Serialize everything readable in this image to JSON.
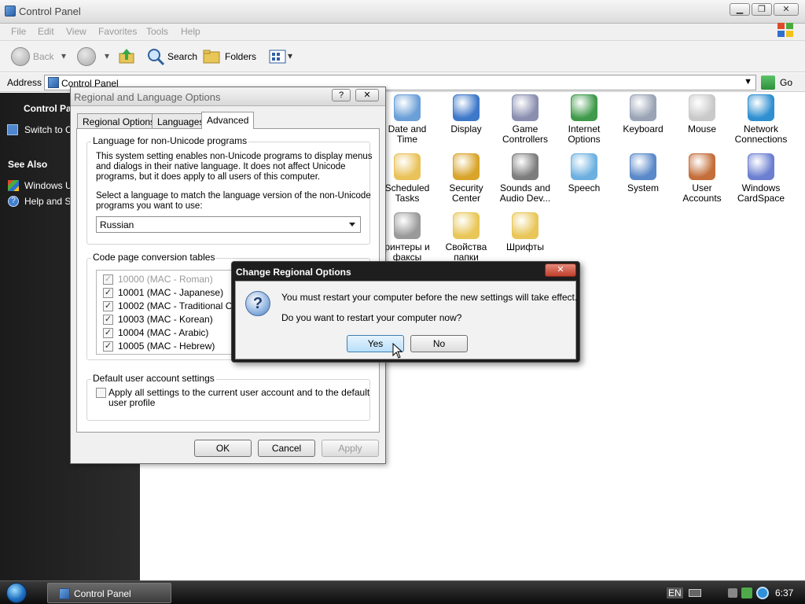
{
  "window": {
    "title": "Control Panel",
    "menu": [
      "File",
      "Edit",
      "View",
      "Favorites",
      "Tools",
      "Help"
    ],
    "toolbar": {
      "back": "Back",
      "search": "Search",
      "folders": "Folders"
    },
    "address_label": "Address",
    "address_value": "Control Panel",
    "go_label": "Go"
  },
  "sidebar": {
    "panel_title": "Control Pal",
    "switch_link": "Switch to C",
    "see_also": "See Also",
    "links": [
      "Windows U",
      "Help and S"
    ]
  },
  "control_panel": {
    "items": [
      {
        "label": "Date and\nTime",
        "color": "#6a9fd8"
      },
      {
        "label": "Display",
        "color": "#3d78c9"
      },
      {
        "label": "Game\nControllers",
        "color": "#8a8fb0"
      },
      {
        "label": "Internet\nOptions",
        "color": "#3f9a4b"
      },
      {
        "label": "Keyboard",
        "color": "#9aa4b5"
      },
      {
        "label": "Mouse",
        "color": "#c9c9c9"
      },
      {
        "label": "Network\nConnections",
        "color": "#2f8fd0"
      },
      {
        "label": "Scheduled\nTasks",
        "color": "#e9c25a"
      },
      {
        "label": "Security\nCenter",
        "color": "#d8a42a"
      },
      {
        "label": "Sounds and\nAudio Dev...",
        "color": "#7d7d7d"
      },
      {
        "label": "Speech",
        "color": "#6db0e0"
      },
      {
        "label": "System",
        "color": "#5a88c8"
      },
      {
        "label": "User\nAccounts",
        "color": "#c46e3a"
      },
      {
        "label": "Windows\nCardSpace",
        "color": "#6c7fd0"
      },
      {
        "label": "ринтеры и\nфаксы",
        "color": "#9a9a9a"
      },
      {
        "label": "Свойства\nпапки",
        "color": "#e8c657"
      },
      {
        "label": "Шрифты",
        "color": "#e8c657"
      }
    ]
  },
  "regional_dialog": {
    "title": "Regional and Language Options",
    "help_btn": "?",
    "close_btn": "✕",
    "tabs": [
      "Regional Options",
      "Languages",
      "Advanced"
    ],
    "group1_label": "Language for non-Unicode programs",
    "group1_text1": "This system setting enables non-Unicode programs to display menus\nand dialogs in their native language. It does not affect Unicode\nprograms, but it does apply to all users of this computer.",
    "group1_text2": "Select a language to match the language version of the non-Unicode\nprograms you want to use:",
    "language_selected": "Russian",
    "group2_label": "Code page conversion tables",
    "code_pages": [
      {
        "label": "10000 (MAC - Roman)",
        "checked": true,
        "disabled": true
      },
      {
        "label": "10001 (MAC - Japanese)",
        "checked": true,
        "disabled": false
      },
      {
        "label": "10002 (MAC - Traditional Chine",
        "checked": true,
        "disabled": false
      },
      {
        "label": "10003 (MAC - Korean)",
        "checked": true,
        "disabled": false
      },
      {
        "label": "10004 (MAC - Arabic)",
        "checked": true,
        "disabled": false
      },
      {
        "label": "10005 (MAC - Hebrew)",
        "checked": true,
        "disabled": false
      }
    ],
    "group3_label": "Default user account settings",
    "apply_all_text": "Apply all settings to the current user account and to the default\nuser profile",
    "ok": "OK",
    "cancel": "Cancel",
    "apply": "Apply"
  },
  "change_dialog": {
    "title": "Change Regional Options",
    "close": "✕",
    "message1": "You must restart your computer before the new settings will take effect.",
    "message2": "Do you want to restart your computer now?",
    "yes": "Yes",
    "no": "No"
  },
  "taskbar": {
    "task": "Control Panel",
    "lang": "EN",
    "time": "6:37"
  }
}
